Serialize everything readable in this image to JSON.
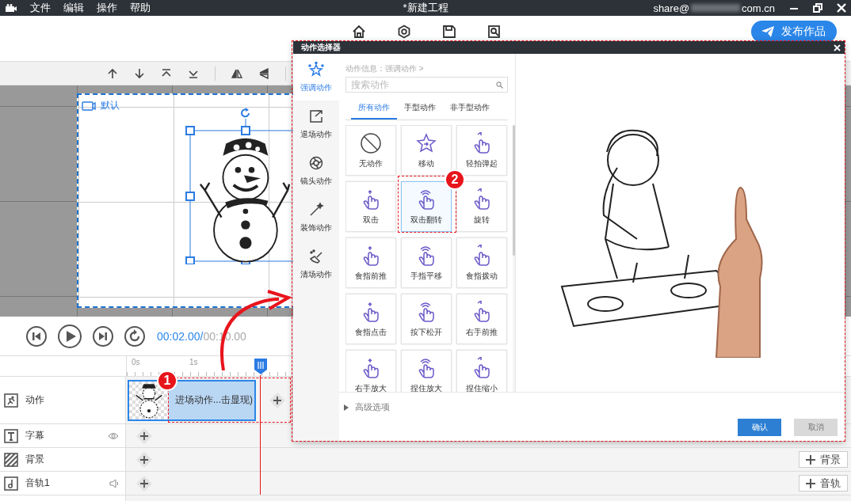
{
  "menu_bar": {
    "items": [
      "文件",
      "编辑",
      "操作",
      "帮助"
    ],
    "title": "*新建工程",
    "account_user": "share@",
    "account_domain": "com.cn"
  },
  "toolbar": {
    "publish_button": "发布作品"
  },
  "stage": {
    "label": "默认"
  },
  "playback": {
    "current_time": "00:02.00/",
    "total_time": "00:10.00"
  },
  "timeline": {
    "ticks": [
      "0s",
      "1s"
    ],
    "tracks": [
      {
        "kind": "action",
        "label": "动作"
      },
      {
        "kind": "subtitle",
        "label": "字幕"
      },
      {
        "kind": "background",
        "label": "背景",
        "add_button": "背景"
      },
      {
        "kind": "audio",
        "label": "音轨1",
        "add_button": "音轨"
      }
    ],
    "clip": {
      "label": "进场动作...击显现)",
      "selected": true
    }
  },
  "dialog": {
    "title": "动作选择器",
    "categories": [
      {
        "label": "强调动作",
        "selected": true
      },
      {
        "label": "退场动作",
        "selected": false
      },
      {
        "label": "镜头动作",
        "selected": false
      },
      {
        "label": "装饰动作",
        "selected": false
      },
      {
        "label": "清场动作",
        "selected": false
      }
    ],
    "breadcrumb": "动作信息：强调动作 >",
    "search": {
      "placeholder": "搜索动作"
    },
    "tabs": [
      {
        "label": "所有动作",
        "selected": true
      },
      {
        "label": "手型动作",
        "selected": false
      },
      {
        "label": "非手型动作",
        "selected": false
      }
    ],
    "actions": [
      {
        "label": "无动作",
        "selected": false
      },
      {
        "label": "移动",
        "selected": false
      },
      {
        "label": "轻拍弹起",
        "selected": false
      },
      {
        "label": "双击",
        "selected": false
      },
      {
        "label": "双击翻转",
        "selected": true
      },
      {
        "label": "旋转",
        "selected": false
      },
      {
        "label": "食指前推",
        "selected": false
      },
      {
        "label": "手指平移",
        "selected": false
      },
      {
        "label": "食指拨动",
        "selected": false
      },
      {
        "label": "食指点击",
        "selected": false
      },
      {
        "label": "按下松开",
        "selected": false
      },
      {
        "label": "右手前推",
        "selected": false
      },
      {
        "label": "右手放大",
        "selected": false
      },
      {
        "label": "捏住放大",
        "selected": false
      },
      {
        "label": "捏住缩小",
        "selected": false
      }
    ],
    "advanced": "高级选项",
    "confirm_button": "确认",
    "cancel_button": "取消"
  },
  "annotations": [
    {
      "number": "1"
    },
    {
      "number": "2"
    }
  ]
}
